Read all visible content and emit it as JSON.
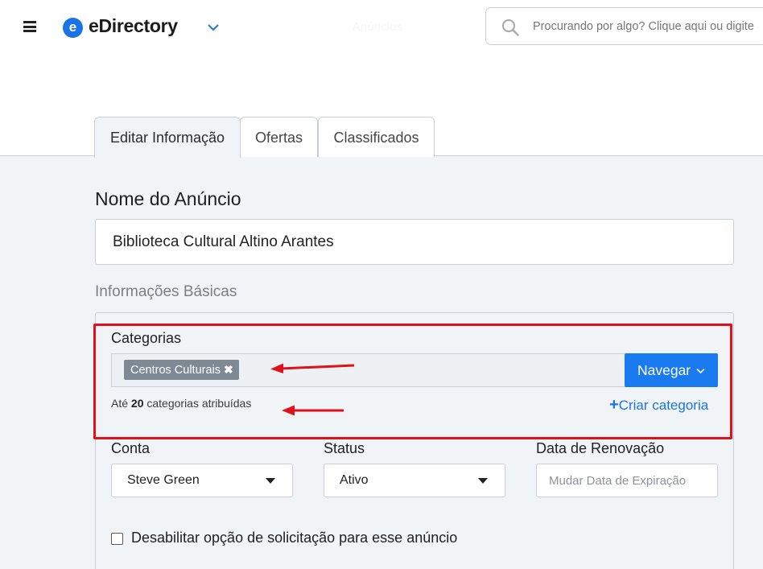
{
  "header": {
    "logo_letter": "e",
    "logo_text": "eDirectory",
    "faded_text": "Anúncios",
    "search_placeholder": "Procurando por algo? Clique aqui ou digite",
    "icons": [
      "hamburger-icon",
      "chevron-down-icon",
      "search-icon"
    ]
  },
  "tabs": [
    {
      "label": "Editar Informação",
      "active": true
    },
    {
      "label": "Ofertas",
      "active": false
    },
    {
      "label": "Classificados",
      "active": false
    }
  ],
  "form": {
    "name_label": "Nome do Anúncio",
    "name_value": "Biblioteca Cultural Altino Arantes",
    "section_label": "Informações Básicas",
    "categories": {
      "label": "Categorias",
      "chips": [
        "Centros Culturais"
      ],
      "chip_remove": "✖",
      "browse_button": "Navegar",
      "hint_prefix": "Até",
      "hint_count": "20",
      "hint_suffix": "categorias atribuídas",
      "create_link": "Criar categoria",
      "create_icon": "+"
    },
    "account": {
      "label": "Conta",
      "value": "Steve Green"
    },
    "status": {
      "label": "Status",
      "value": "Ativo"
    },
    "renewal": {
      "label": "Data de Renovação",
      "placeholder": "Mudar Data de Expiração"
    },
    "disable_request_label": "Desabilitar opção de solicitação para esse anúncio",
    "disable_request_checked": false
  },
  "colors": {
    "accent": "#1a7bf0",
    "highlight": "#e0111a",
    "chip": "#7d8995",
    "page_bg": "#f1f4f7"
  }
}
